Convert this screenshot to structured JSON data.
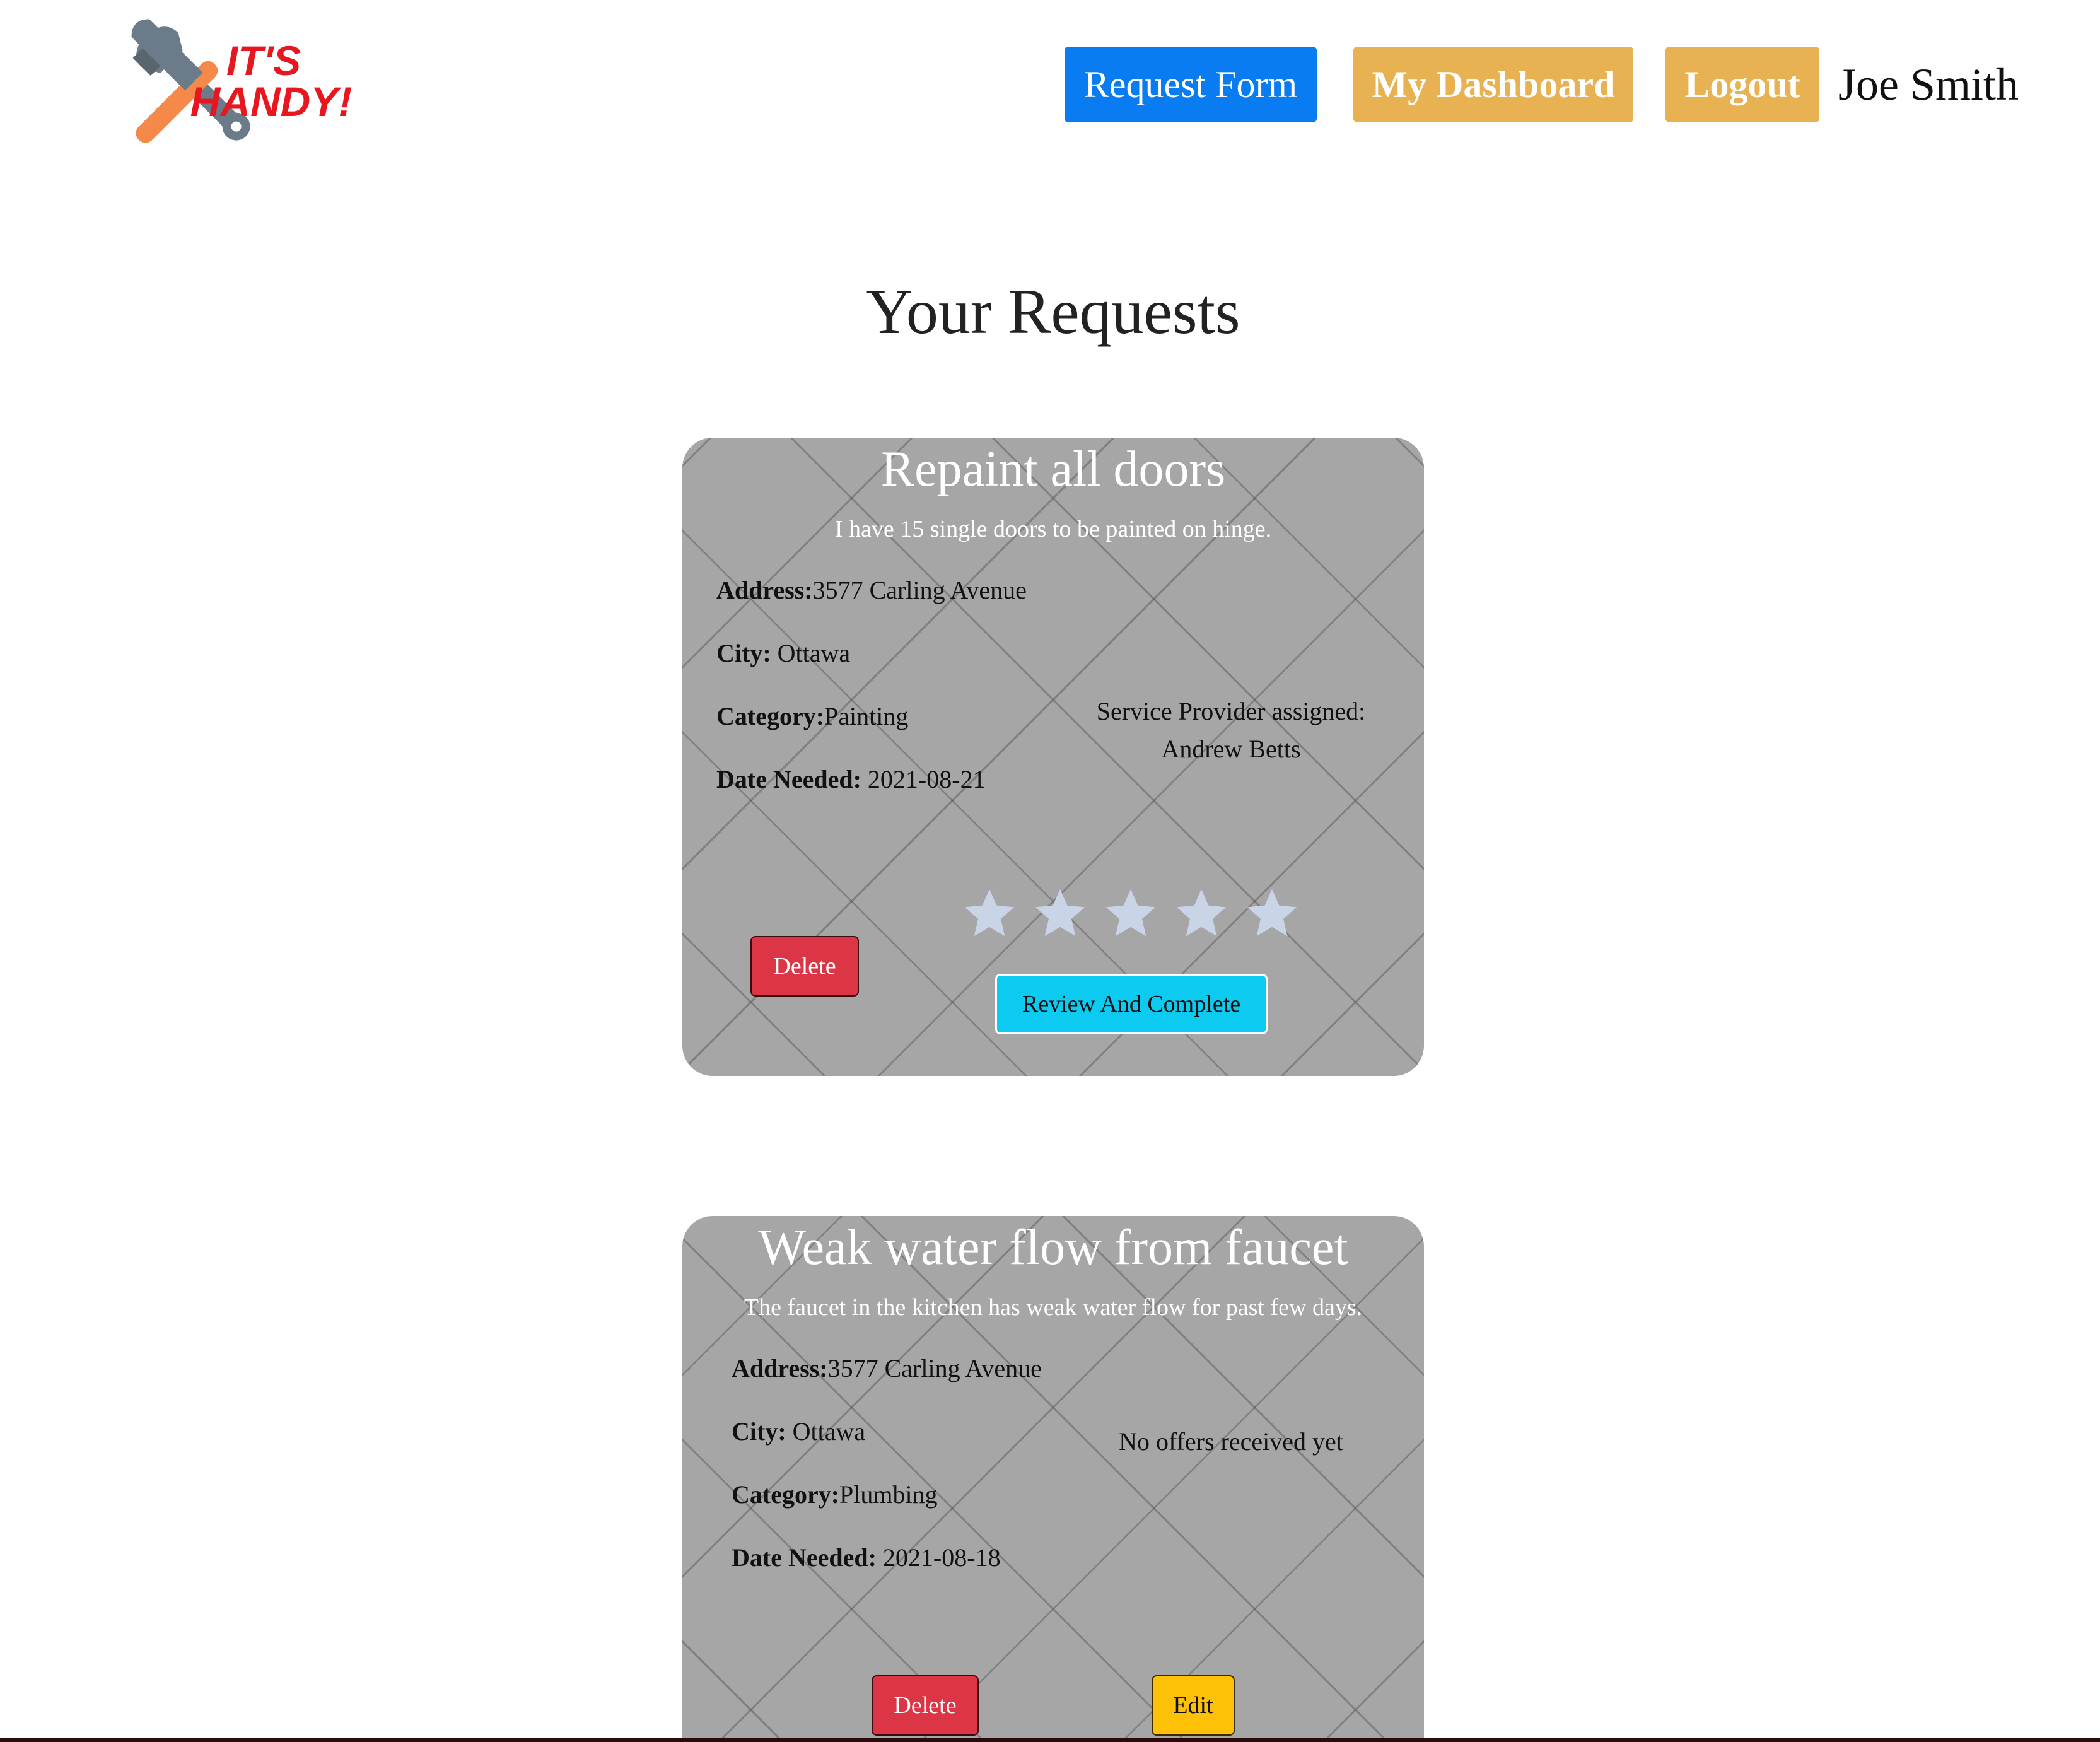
{
  "header": {
    "logo_text_line1": "IT'S",
    "logo_text_line2": "HANDY!",
    "request_form_label": "Request Form",
    "dashboard_label": "My Dashboard",
    "logout_label": "Logout",
    "user_name": "Joe Smith"
  },
  "main": {
    "title": "Your Requests"
  },
  "requests": [
    {
      "title": "Repaint all doors",
      "description": "I have 15 single doors to be painted on hinge.",
      "address_label": "Address:",
      "address": "3577 Carling Avenue",
      "city_label": "City:",
      "city": "Ottawa",
      "category_label": "Category:",
      "category": "Painting",
      "date_label": "Date Needed:",
      "date": "2021-08-21",
      "provider_line1": "Service Provider assigned:",
      "provider_line2": "Andrew Betts",
      "rating": 0,
      "rating_max": 5,
      "delete_label": "Delete",
      "review_label": "Review And Complete"
    },
    {
      "title": "Weak water flow from faucet",
      "description": "The faucet in the kitchen has weak water flow for past few days.",
      "address_label": "Address:",
      "address": "3577 Carling Avenue",
      "city_label": "City:",
      "city": "Ottawa",
      "category_label": "Category:",
      "category": "Plumbing",
      "date_label": "Date Needed:",
      "date": "2021-08-18",
      "status": "No offers received yet",
      "delete_label": "Delete",
      "edit_label": "Edit"
    }
  ],
  "colors": {
    "primary_button": "#0a7cf2",
    "warning_button": "#e8b252",
    "delete_button": "#dc3545",
    "review_button": "#0dcaf0",
    "edit_button": "#ffc107",
    "card_background": "#a6a6a6",
    "star_empty": "#c9d4e6"
  },
  "icons": {
    "logo": "hammer-wrench-logo",
    "star": "star-icon"
  }
}
